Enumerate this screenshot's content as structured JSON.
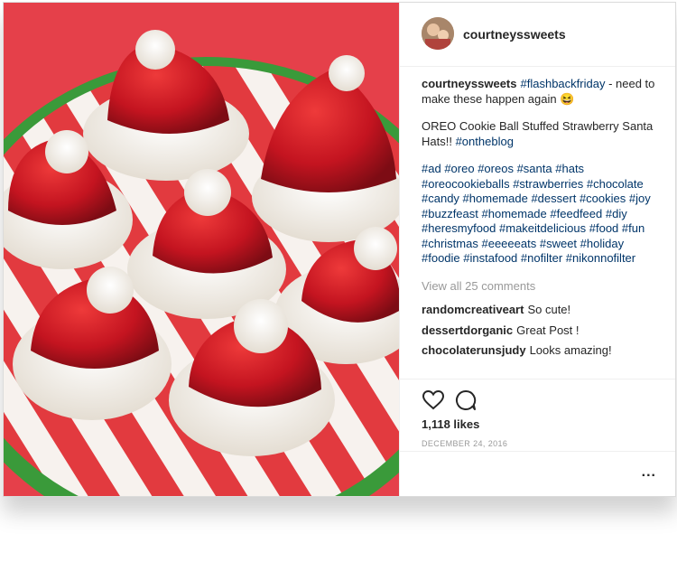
{
  "post": {
    "username": "courtneyssweets",
    "caption_user": "courtneyssweets",
    "caption_line1": [
      {
        "text": "#flashbackfriday",
        "tag": true
      },
      {
        "text": " - need to make these happen again 😆",
        "tag": false
      }
    ],
    "caption_line2": [
      {
        "text": "OREO Cookie Ball Stuffed Strawberry Santa Hats!! ",
        "tag": false
      },
      {
        "text": "#ontheblog",
        "tag": true
      }
    ],
    "hashtags": [
      "#ad",
      "#oreo",
      "#oreos",
      "#santa",
      "#hats",
      "#oreocookieballs",
      "#strawberries",
      "#chocolate",
      "#candy",
      "#homemade",
      "#dessert",
      "#cookies",
      "#joy",
      "#buzzfeast",
      "#homemade",
      "#feedfeed",
      "#diy",
      "#heresmyfood",
      "#makeitdelicious",
      "#food",
      "#fun",
      "#christmas",
      "#eeeeeats",
      "#sweet",
      "#holiday",
      "#foodie",
      "#instafood",
      "#nofilter",
      "#nikonnofilter"
    ],
    "view_all": "View all 25 comments",
    "comments": [
      {
        "user": "randomcreativeart",
        "text": "So cute!"
      },
      {
        "user": "dessertdorganic",
        "text": "Great Post !"
      },
      {
        "user": "chocolaterunsjudy",
        "text": "Looks amazing!"
      }
    ],
    "likes": "1,118 likes",
    "date": "DECEMBER 24, 2016",
    "more": "..."
  },
  "icons": {
    "like": "heart-icon",
    "comment": "comment-icon",
    "more": "more-options-icon"
  },
  "colors": {
    "link": "#003569",
    "muted": "#999999",
    "text": "#262626",
    "photo_bg": "#e5404a",
    "strawberry": "#c9151e",
    "coconut": "#f3f0ea",
    "plate_rim": "#3a9a3a"
  }
}
